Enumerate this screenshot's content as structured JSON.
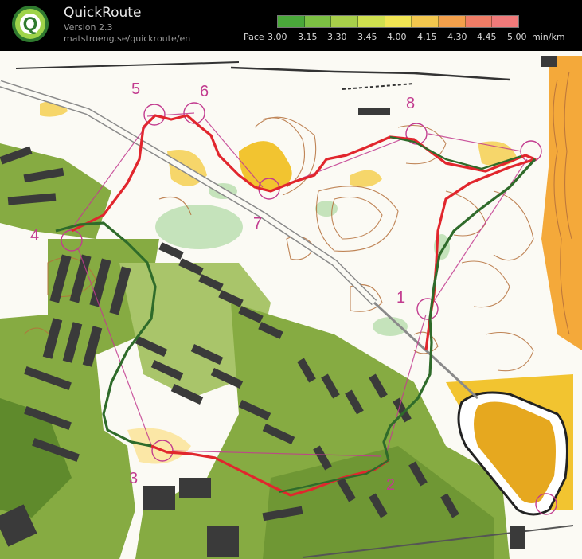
{
  "header": {
    "app_name": "QuickRoute",
    "version": "Version 2.3",
    "url": "matstroeng.se/quickroute/en",
    "logo_letter": "Q"
  },
  "legend": {
    "pace_label": "Pace",
    "ticks": [
      "3.00",
      "3.15",
      "3.30",
      "3.45",
      "4.00",
      "4.15",
      "4.30",
      "4.45",
      "5.00"
    ],
    "unit": "min/km",
    "gradient_colors": [
      "#4aa83a",
      "#7cc043",
      "#a8cf4a",
      "#cfe04f",
      "#f1e553",
      "#f3c74e",
      "#f3a04b",
      "#f07d66",
      "#f07a7a"
    ]
  },
  "map": {
    "control_numbers": [
      "1",
      "2",
      "3",
      "4",
      "5",
      "6",
      "7",
      "8"
    ],
    "colors": {
      "open": "#f2c430",
      "forest_green": "#7fa63a",
      "contour": "#b5703b",
      "course": "#c23b8f",
      "route_red": "#e1262d",
      "route_green": "#2f6b2a",
      "building": "#3a3a3a",
      "paper": "#fbfaf4"
    }
  }
}
